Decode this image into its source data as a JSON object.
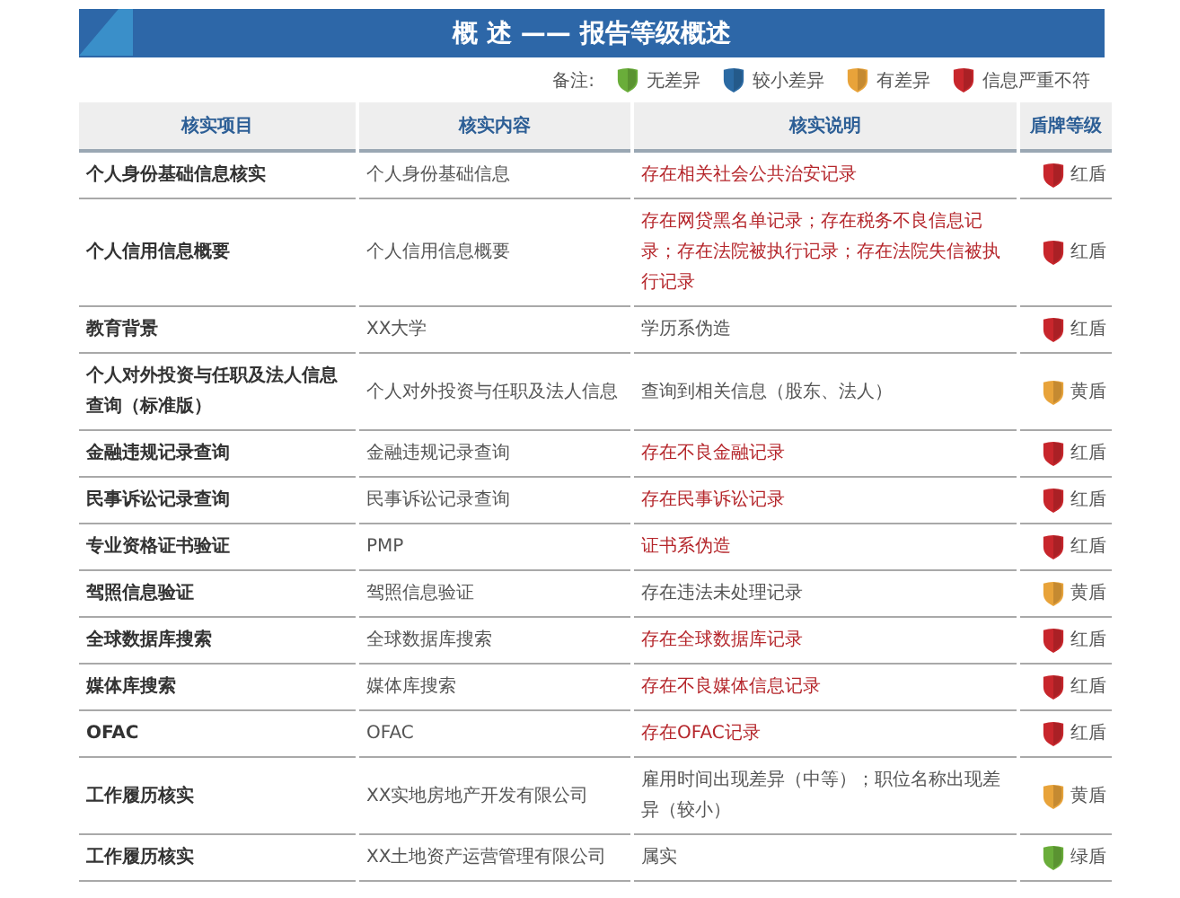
{
  "header": {
    "title": "概 述 —— 报告等级概述"
  },
  "legend": {
    "label": "备注:",
    "items": [
      {
        "color": "#6aad3a",
        "label": "无差异"
      },
      {
        "color": "#2b6aa3",
        "label": "较小差异"
      },
      {
        "color": "#e8a33a",
        "label": "有差异"
      },
      {
        "color": "#c8262c",
        "label": "信息严重不符"
      }
    ]
  },
  "table": {
    "columns": [
      "核实项目",
      "核实内容",
      "核实说明",
      "盾牌等级"
    ],
    "rows": [
      {
        "item": "个人身份基础信息核实",
        "content": "个人身份基础信息",
        "note": "存在相关社会公共治安记录",
        "flagged": true,
        "shield": {
          "color": "#c8262c",
          "label": "红盾"
        }
      },
      {
        "item": "个人信用信息概要",
        "content": "个人信用信息概要",
        "note": "存在网贷黑名单记录；存在税务不良信息记录；存在法院被执行记录；存在法院失信被执行记录",
        "flagged": true,
        "shield": {
          "color": "#c8262c",
          "label": "红盾"
        }
      },
      {
        "item": "教育背景",
        "content": "XX大学",
        "note": "学历系伪造",
        "flagged": false,
        "shield": {
          "color": "#c8262c",
          "label": "红盾"
        }
      },
      {
        "item": "个人对外投资与任职及法人信息查询（标准版）",
        "content": "个人对外投资与任职及法人信息",
        "note": "查询到相关信息（股东、法人）",
        "flagged": false,
        "shield": {
          "color": "#e8a33a",
          "label": "黄盾"
        }
      },
      {
        "item": "金融违规记录查询",
        "content": "金融违规记录查询",
        "note": "存在不良金融记录",
        "flagged": true,
        "shield": {
          "color": "#c8262c",
          "label": "红盾"
        }
      },
      {
        "item": "民事诉讼记录查询",
        "content": "民事诉讼记录查询",
        "note": "存在民事诉讼记录",
        "flagged": true,
        "shield": {
          "color": "#c8262c",
          "label": "红盾"
        }
      },
      {
        "item": "专业资格证书验证",
        "content": "PMP",
        "note": "证书系伪造",
        "flagged": true,
        "shield": {
          "color": "#c8262c",
          "label": "红盾"
        }
      },
      {
        "item": "驾照信息验证",
        "content": "驾照信息验证",
        "note": "存在违法未处理记录",
        "flagged": false,
        "shield": {
          "color": "#e8a33a",
          "label": "黄盾"
        }
      },
      {
        "item": "全球数据库搜索",
        "content": "全球数据库搜索",
        "note": "存在全球数据库记录",
        "flagged": true,
        "shield": {
          "color": "#c8262c",
          "label": "红盾"
        }
      },
      {
        "item": "媒体库搜索",
        "content": "媒体库搜索",
        "note": "存在不良媒体信息记录",
        "flagged": true,
        "shield": {
          "color": "#c8262c",
          "label": "红盾"
        }
      },
      {
        "item": "OFAC",
        "content": "OFAC",
        "note": "存在OFAC记录",
        "flagged": true,
        "shield": {
          "color": "#c8262c",
          "label": "红盾"
        }
      },
      {
        "item": "工作履历核实",
        "content": "XX实地房地产开发有限公司",
        "note": "雇用时间出现差异（中等）；职位名称出现差异（较小）",
        "flagged": false,
        "shield": {
          "color": "#e8a33a",
          "label": "黄盾"
        }
      },
      {
        "item": "工作履历核实",
        "content": "XX土地资产运营管理有限公司",
        "note": "属实",
        "flagged": false,
        "shield": {
          "color": "#6aad3a",
          "label": "绿盾"
        }
      }
    ]
  }
}
